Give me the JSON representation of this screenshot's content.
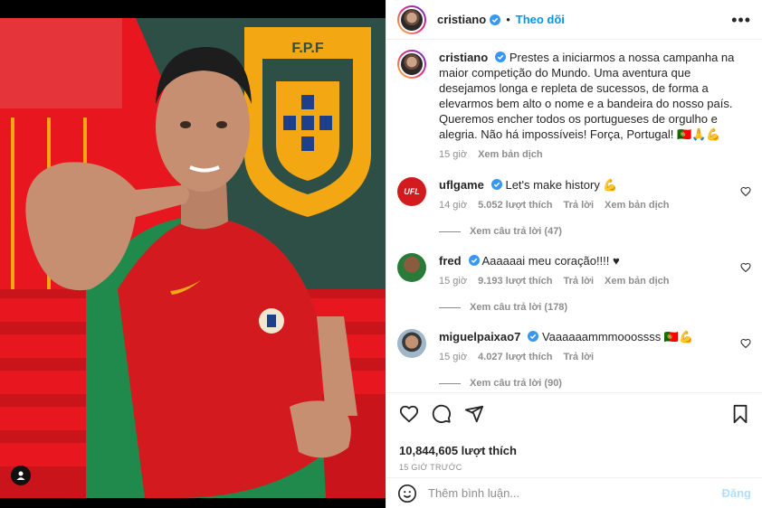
{
  "post": {
    "author": "cristiano",
    "follow_label": "Theo dõi",
    "caption": "Prestes a iniciarmos a nossa campanha na maior competição do Mundo. Uma aventura que desejamos longa e repleta de sucessos, de forma a elevarmos bem alto o nome e a bandeira do nosso país. Queremos encher todos os portugueses de orgulho e alegria. Não há impossíveis! Força, Portugal! 🇵🇹🙏💪",
    "caption_time": "15 giờ",
    "translate_label": "Xem bản dịch",
    "likes": "10,844,605 lượt thích",
    "posted_ago": "15 GIỜ TRƯỚC",
    "photo_badge": "F.P.F"
  },
  "comments": [
    {
      "user": "uflgame",
      "avatar_text": "UFL",
      "text": "Let's make history 💪",
      "time": "14 giờ",
      "likes": "5.052 lượt thích",
      "reply": "Trả lời",
      "translate": "Xem bản dịch",
      "view_replies": "Xem câu trả lời (47)"
    },
    {
      "user": "fred",
      "text": "Aaaaaai meu coração!!!! ♥",
      "time": "15 giờ",
      "likes": "9.193 lượt thích",
      "reply": "Trả lời",
      "translate": "Xem bản dịch",
      "view_replies": "Xem câu trả lời (178)"
    },
    {
      "user": "miguelpaixao7",
      "text": "Vaaaaaammmooossss 🇵🇹💪",
      "time": "15 giờ",
      "likes": "4.027 lượt thích",
      "reply": "Trả lời",
      "view_replies": "Xem câu trả lời (90)"
    }
  ],
  "composer": {
    "placeholder": "Thêm bình luận...",
    "post_label": "Đăng"
  },
  "colors": {
    "accent": "#0095f6",
    "verified": "#3897f0",
    "jersey_red": "#d31b1f",
    "jersey_green": "#1f8a4c"
  }
}
